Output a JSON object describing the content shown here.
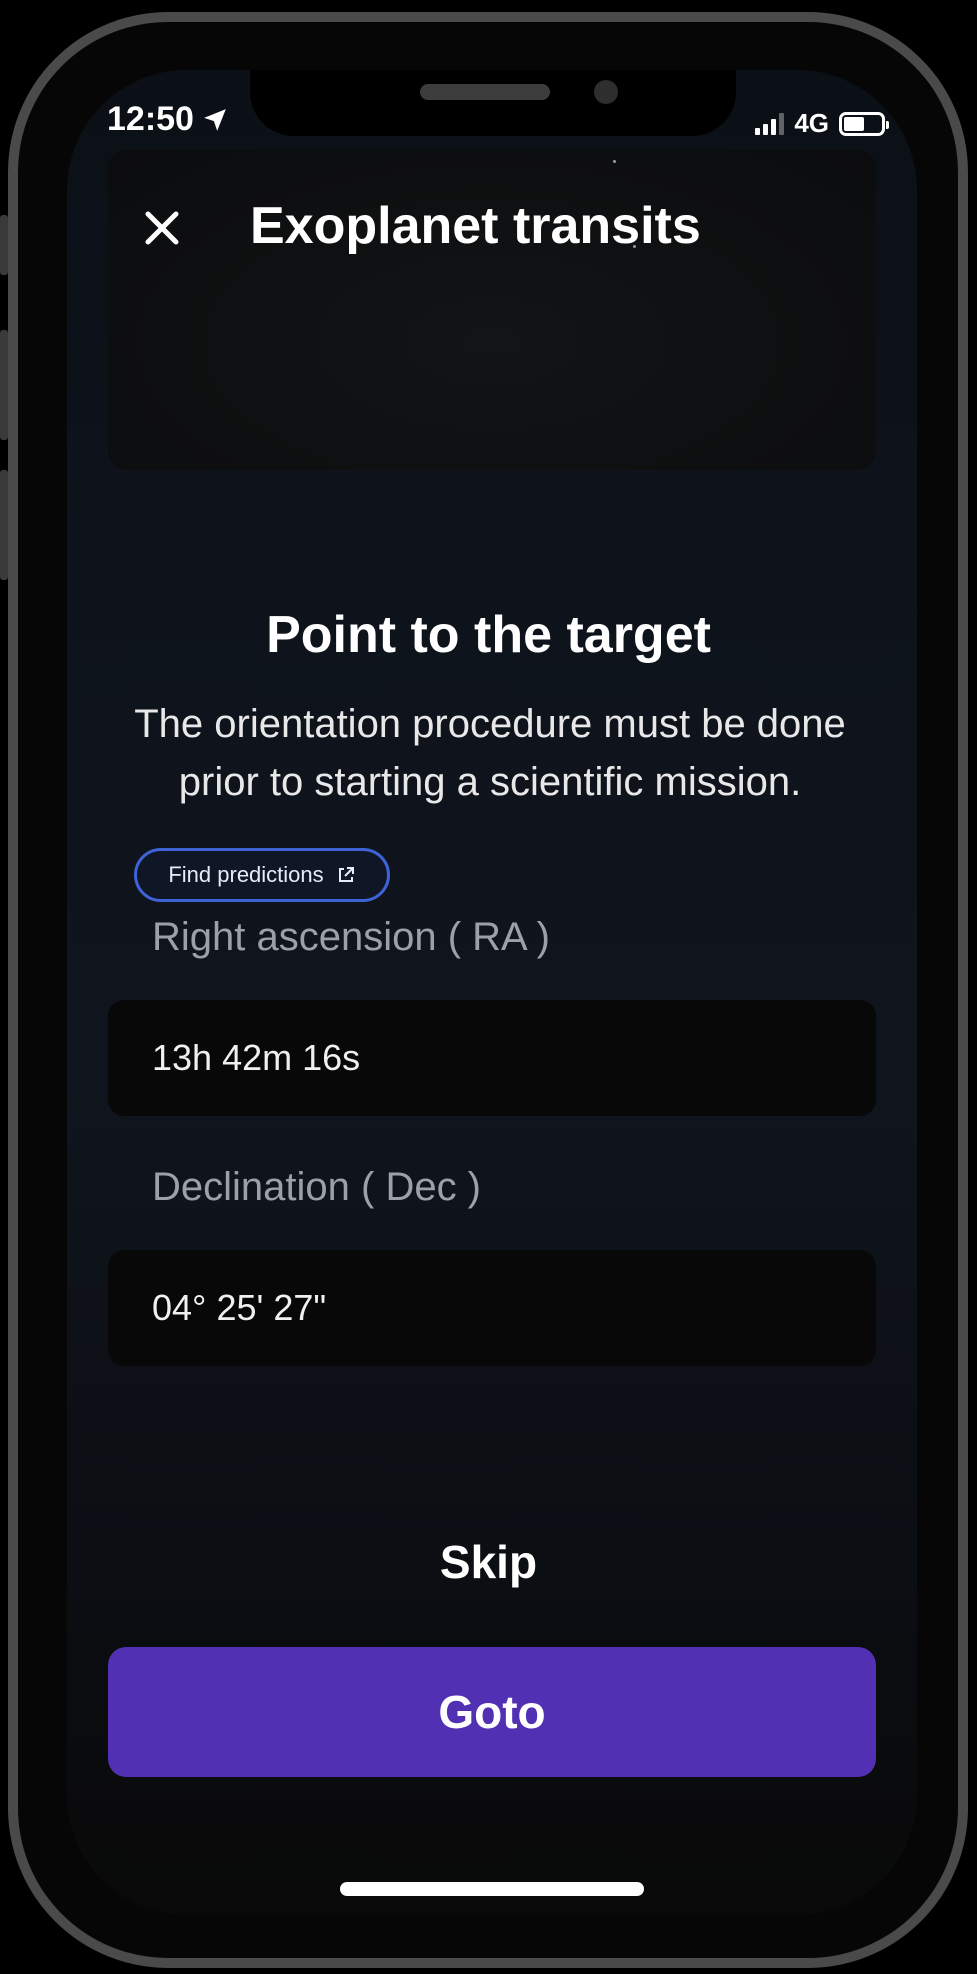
{
  "status_bar": {
    "time": "12:50",
    "network": "4G",
    "battery_level": 0.55,
    "signal_bars": 3
  },
  "header": {
    "title": "Exoplanet transits",
    "close_icon": "close-icon"
  },
  "main": {
    "section_title": "Point to the target",
    "description": "The orientation procedure must be done prior to starting a scientific mission.",
    "find_predictions_label": "Find predictions",
    "ra_label": "Right ascension ( RA )",
    "ra_value": "13h 42m 16s",
    "dec_label": "Declination ( Dec )",
    "dec_value": "04° 25' 27\""
  },
  "actions": {
    "skip_label": "Skip",
    "goto_label": "Goto"
  },
  "colors": {
    "accent_button": "#5130b3",
    "link_border": "#3f63d6"
  }
}
